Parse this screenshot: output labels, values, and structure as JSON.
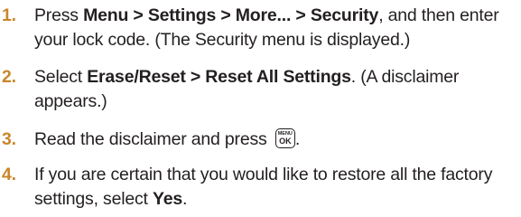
{
  "steps": [
    {
      "number": "1.",
      "parts": {
        "a": "Press ",
        "b_menu": "Menu > Settings > More... > Security",
        "c": ", and then enter your lock code. (The Security menu is displayed.)"
      }
    },
    {
      "number": "2.",
      "parts": {
        "a": "Select ",
        "b_menu": "Erase/Reset > Reset All Settings",
        "c": ". (A disclaimer appears.)"
      }
    },
    {
      "number": "3.",
      "parts": {
        "a": "Read the disclaimer and press ",
        "key_top": "MENU",
        "key_bottom": "OK",
        "key_icon": "menu-ok-key-icon",
        "c": "."
      }
    },
    {
      "number": "4.",
      "parts": {
        "a": "If you are certain that you would like to restore all the factory settings, select ",
        "b_menu": "Yes",
        "c": "."
      }
    }
  ],
  "colors": {
    "step_number": "#c9872a",
    "text": "#231f20"
  }
}
